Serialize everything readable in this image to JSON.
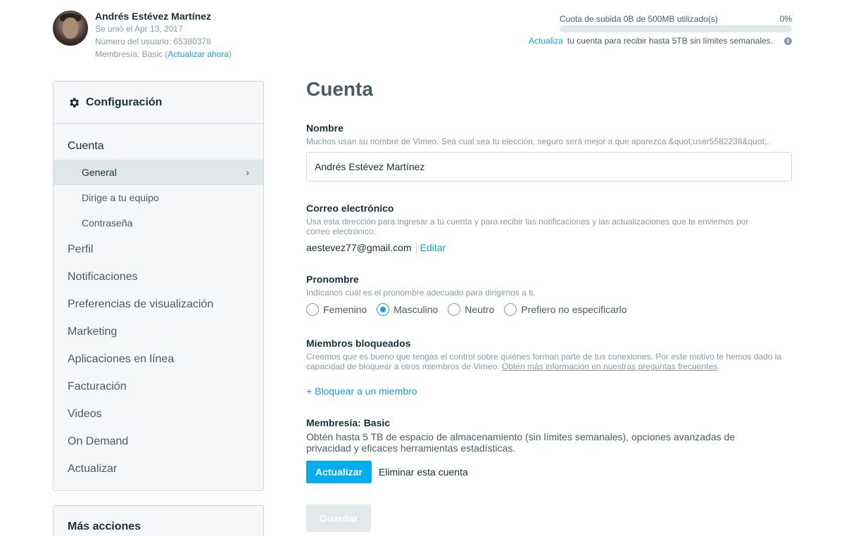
{
  "user": {
    "name": "Andrés Estévez Martínez",
    "joined": "Se unió el Apr 13, 2017",
    "user_number": "Número del usuario: 65380378",
    "membership_prefix": "Membresía: Basic (",
    "membership_link": "Actualizar ahora",
    "membership_suffix": ")"
  },
  "quota": {
    "label": "Cuota de subida 0B de 500MB utilizado(s)",
    "percent_label": "0%",
    "used_fraction": 0,
    "upgrade_link": "Actualiza",
    "upgrade_text": "tu cuenta para recibir hasta 5TB sin límites semanales.",
    "info_icon": "info-icon"
  },
  "sidebar": {
    "title": "Configuración",
    "title_icon": "gear-icon",
    "items": [
      {
        "label": "Cuenta",
        "type": "top"
      },
      {
        "label": "General",
        "type": "sub",
        "active": true
      },
      {
        "label": "Dirige a tu equipo",
        "type": "sub"
      },
      {
        "label": "Contraseña",
        "type": "sub"
      },
      {
        "label": "Perfil",
        "type": "top"
      },
      {
        "label": "Notificaciones",
        "type": "top"
      },
      {
        "label": "Preferencias de visualización",
        "type": "top"
      },
      {
        "label": "Marketing",
        "type": "top"
      },
      {
        "label": "Aplicaciones en línea",
        "type": "top"
      },
      {
        "label": "Facturación",
        "type": "top"
      },
      {
        "label": "Videos",
        "type": "top"
      },
      {
        "label": "On Demand",
        "type": "top"
      },
      {
        "label": "Actualizar",
        "type": "top"
      }
    ],
    "more_title": "Más acciones"
  },
  "main": {
    "title": "Cuenta",
    "name": {
      "label": "Nombre",
      "help": "Muchos usan su nombre de Vimeo. Sea cual sea tu elección, seguro será mejor a que aparezca &quot;user5582238&quot;.",
      "value": "Andrés Estévez Martínez"
    },
    "email": {
      "label": "Correo electrónico",
      "help_line1": "Usa esta dirección para ingresar a tu cuenta y para recibir las notificaciones y las actualizaciones que te enviemos por",
      "help_line2": "correo electrónico.",
      "value": "aestevez77@gmail.com",
      "edit": "Editar"
    },
    "pronoun": {
      "label": "Pronombre",
      "help": "Indícanos cuál es el pronombre adecuado para dirigirnos a ti.",
      "options": [
        "Femenino",
        "Masculino",
        "Neutro",
        "Prefiero no especificarlo"
      ],
      "selected": "Masculino"
    },
    "blocked": {
      "label": "Miembros bloqueados",
      "help_line1": "Creemos que es bueno que tengas el control sobre quiénes forman parte de tus conexiones. Por este motivo te hemos dado la",
      "help_line2_prefix": "capacidad de bloquear a otros miembros de Vimeo.",
      "help_link": "Obtén más información en nuestras preguntas frecuentes",
      "help_suffix": ".",
      "add_link": "+ Bloquear a un miembro"
    },
    "membership": {
      "label": "Membresía: Basic",
      "text_line1": "Obtén hasta 5 TB de espacio de almacenamiento (sin límites semanales), opciones avanzadas de",
      "text_line2": "privacidad y eficaces herramientas estadísticas.",
      "upgrade_button": "Actualizar",
      "delete_link": "Eliminar esta cuenta"
    },
    "save_button": "Guardar"
  }
}
